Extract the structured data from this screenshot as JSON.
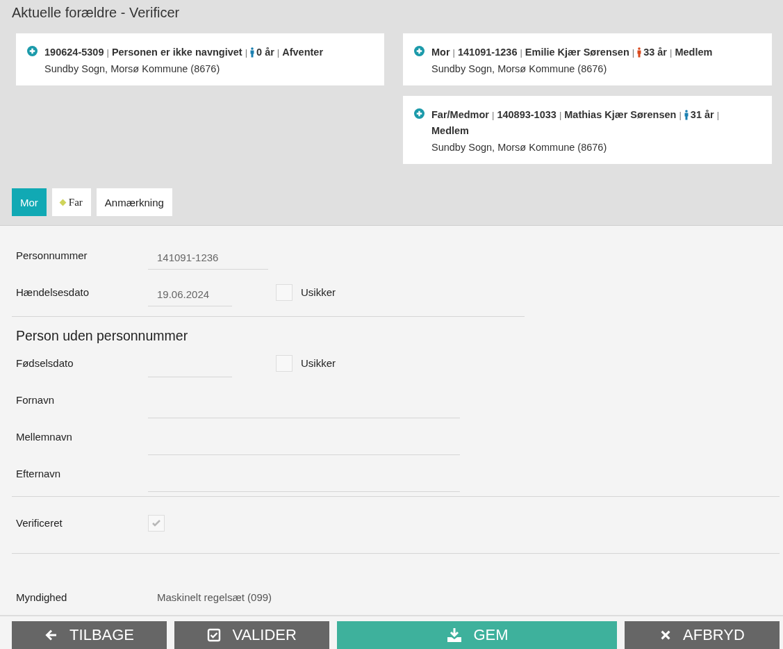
{
  "header": {
    "title": "Aktuelle forældre - Verificer"
  },
  "cards_left": [
    {
      "items": [
        {
          "kind": "bold",
          "text": "190624-5309"
        },
        {
          "kind": "sep",
          "text": "|"
        },
        {
          "kind": "bold",
          "text": "Personen er ikke navngivet"
        },
        {
          "kind": "sep",
          "text": "|"
        },
        {
          "kind": "person",
          "color": "#1a7fb0"
        },
        {
          "kind": "bold",
          "text": "0 år"
        },
        {
          "kind": "sep",
          "text": "|"
        },
        {
          "kind": "bold",
          "text": "Afventer"
        }
      ],
      "location": "Sundby Sogn, Morsø Kommune (8676)"
    }
  ],
  "cards_right": [
    {
      "items": [
        {
          "kind": "bold",
          "text": "Mor"
        },
        {
          "kind": "sep",
          "text": "|"
        },
        {
          "kind": "bold",
          "text": "141091-1236"
        },
        {
          "kind": "sep",
          "text": "|"
        },
        {
          "kind": "bold",
          "text": "Emilie Kjær Sørensen"
        },
        {
          "kind": "sep",
          "text": "|"
        },
        {
          "kind": "person",
          "color": "#d9481c"
        },
        {
          "kind": "bold",
          "text": "33 år"
        },
        {
          "kind": "sep",
          "text": "|"
        },
        {
          "kind": "bold",
          "text": "Medlem"
        }
      ],
      "location": "Sundby Sogn, Morsø Kommune (8676)"
    },
    {
      "items": [
        {
          "kind": "bold",
          "text": "Far/Medmor"
        },
        {
          "kind": "sep",
          "text": "|"
        },
        {
          "kind": "bold",
          "text": "140893-1033"
        },
        {
          "kind": "sep",
          "text": "|"
        },
        {
          "kind": "bold",
          "text": "Mathias Kjær Sørensen"
        },
        {
          "kind": "sep",
          "text": "|"
        },
        {
          "kind": "person",
          "color": "#1a7fb0"
        },
        {
          "kind": "bold",
          "text": "31 år"
        },
        {
          "kind": "sep",
          "text": "|"
        },
        {
          "kind": "bold",
          "text": "Medlem"
        }
      ],
      "location": "Sundby Sogn, Morsø Kommune (8676)"
    }
  ],
  "tabs": [
    {
      "label": "Mor",
      "selected": true
    },
    {
      "label": "Far",
      "selected": false,
      "marker": true
    },
    {
      "label": "Anmærkning",
      "selected": false
    }
  ],
  "form": {
    "rows": [
      {
        "label": "Personnummer",
        "kind": "text",
        "value": "141091-1236"
      },
      {
        "label": "Hændelsesdato",
        "kind": "date",
        "value": "19.06.2024",
        "uncertain": {
          "label": "Usikker",
          "checked": false
        }
      }
    ],
    "section_title": "Person uden personnummer",
    "person_rows": [
      {
        "label": "Fødselsdato",
        "kind": "date",
        "uncertain": {
          "label": "Usikker",
          "checked": false
        }
      },
      {
        "label": "Fornavn",
        "kind": "name"
      },
      {
        "label": "Mellemnavn",
        "kind": "name"
      },
      {
        "label": "Efternavn",
        "kind": "name"
      }
    ],
    "verified": {
      "label": "Verificeret",
      "checked": true,
      "disabled": true
    },
    "authority": {
      "label": "Myndighed",
      "value": "Maskinelt regelsæt (099)"
    }
  },
  "buttons": [
    {
      "label": "TILBAGE",
      "kind": "back"
    },
    {
      "label": "VALIDER",
      "kind": "validate"
    },
    {
      "label": "GEM",
      "kind": "save"
    },
    {
      "label": "AFBRYD",
      "kind": "cancel"
    }
  ]
}
